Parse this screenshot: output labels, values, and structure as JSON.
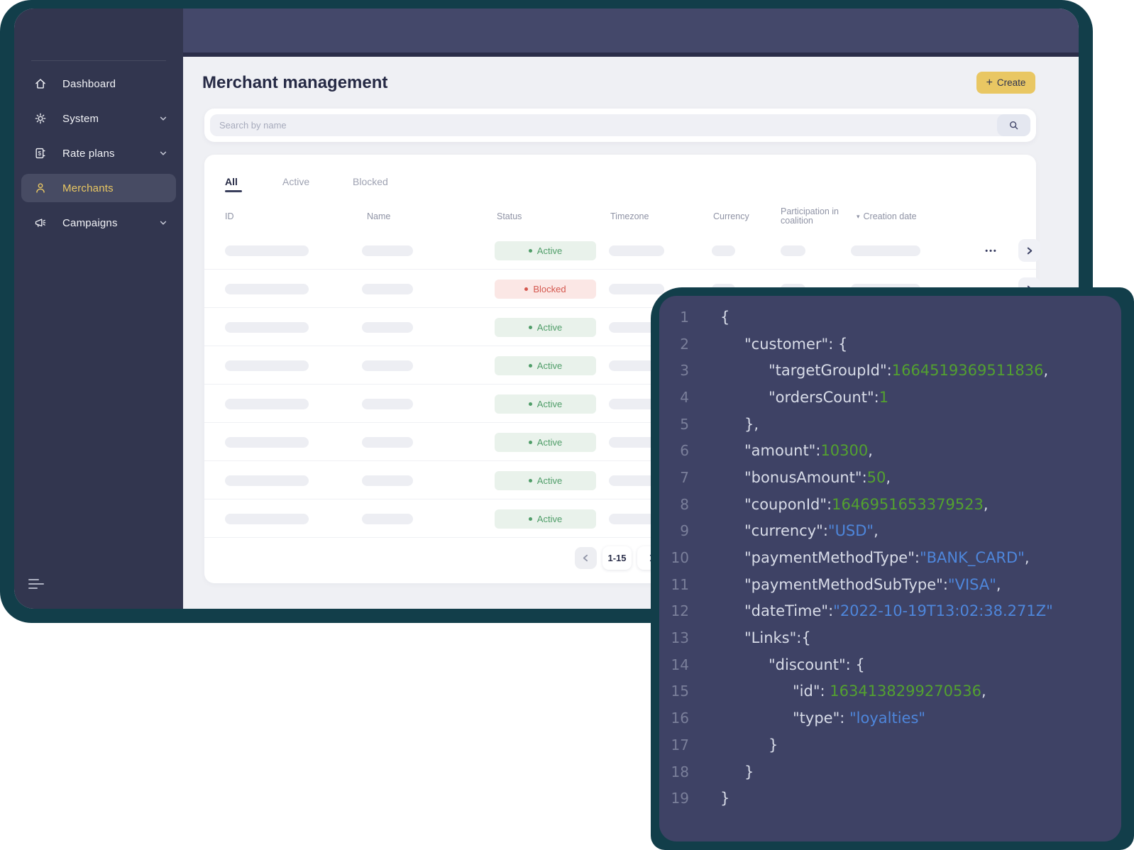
{
  "palette": {
    "teal_frame": "#123E4A",
    "sidebar_bg": "#32364F",
    "topbar_bg": "#44486A",
    "content_bg": "#EFF0F4",
    "accent_gold": "#E9C763",
    "text_dark": "#262A45",
    "text_gray": "#8F93A5",
    "skeleton": "#EDEEF3",
    "active_text": "#4F9D68",
    "active_bg": "#E9F2EB",
    "blocked_text": "#D4574E",
    "blocked_bg": "#FBE7E5",
    "code_panel_bg": "#3E4265",
    "code_line_number": "#7A7F9A",
    "code_key": "#D8DCE8",
    "code_number": "#53A12F",
    "code_string": "#4E86DB"
  },
  "sidebar": {
    "items": [
      {
        "label": "Dashboard",
        "icon": "home-icon",
        "active": false,
        "expandable": false
      },
      {
        "label": "System",
        "icon": "gear-icon",
        "active": false,
        "expandable": true
      },
      {
        "label": "Rate plans",
        "icon": "rate-plans-icon",
        "active": false,
        "expandable": true
      },
      {
        "label": "Merchants",
        "icon": "person-icon",
        "active": true,
        "expandable": false
      },
      {
        "label": "Campaigns",
        "icon": "megaphone-icon",
        "active": false,
        "expandable": true
      }
    ]
  },
  "header": {
    "title": "Merchant management",
    "create_button": "Create",
    "create_plus": "+"
  },
  "search": {
    "placeholder": "Search by name"
  },
  "tabs": [
    {
      "label": "All",
      "active": true
    },
    {
      "label": "Active",
      "active": false
    },
    {
      "label": "Blocked",
      "active": false
    }
  ],
  "table": {
    "columns": [
      "ID",
      "Name",
      "Status",
      "Timezone",
      "Currency",
      "Participation in coalition",
      "Creation date"
    ],
    "sorted_column": "Creation date",
    "sort_caret": "▾",
    "row_menu_glyph": "•••",
    "rows": [
      {
        "status": "Active"
      },
      {
        "status": "Blocked"
      },
      {
        "status": "Active"
      },
      {
        "status": "Active"
      },
      {
        "status": "Active"
      },
      {
        "status": "Active"
      },
      {
        "status": "Active"
      },
      {
        "status": "Active"
      }
    ]
  },
  "pagination": {
    "range": "1-15"
  },
  "code_panel": {
    "lines": [
      {
        "num": 1,
        "indent": 0,
        "tokens": [
          {
            "t": "punc",
            "v": "{"
          }
        ]
      },
      {
        "num": 2,
        "indent": 1,
        "tokens": [
          {
            "t": "key",
            "v": "\"customer\""
          },
          {
            "t": "punc",
            "v": ": {"
          }
        ]
      },
      {
        "num": 3,
        "indent": 2,
        "tokens": [
          {
            "t": "key",
            "v": "\"targetGroupId\""
          },
          {
            "t": "punc",
            "v": ":"
          },
          {
            "t": "num",
            "v": "1664519369511836"
          },
          {
            "t": "punc",
            "v": ","
          }
        ]
      },
      {
        "num": 4,
        "indent": 2,
        "tokens": [
          {
            "t": "key",
            "v": "\"ordersCount\""
          },
          {
            "t": "punc",
            "v": ":"
          },
          {
            "t": "num",
            "v": "1"
          }
        ]
      },
      {
        "num": 5,
        "indent": 1,
        "tokens": [
          {
            "t": "punc",
            "v": "},"
          }
        ]
      },
      {
        "num": 6,
        "indent": 1,
        "tokens": [
          {
            "t": "key",
            "v": "\"amount\""
          },
          {
            "t": "punc",
            "v": ":"
          },
          {
            "t": "num",
            "v": "10300"
          },
          {
            "t": "punc",
            "v": ","
          }
        ]
      },
      {
        "num": 7,
        "indent": 1,
        "tokens": [
          {
            "t": "key",
            "v": "\"bonusAmount\""
          },
          {
            "t": "punc",
            "v": ":"
          },
          {
            "t": "num",
            "v": "50"
          },
          {
            "t": "punc",
            "v": ","
          }
        ]
      },
      {
        "num": 8,
        "indent": 1,
        "tokens": [
          {
            "t": "key",
            "v": "\"couponId\""
          },
          {
            "t": "punc",
            "v": ":"
          },
          {
            "t": "num",
            "v": "1646951653379523"
          },
          {
            "t": "punc",
            "v": ","
          }
        ]
      },
      {
        "num": 9,
        "indent": 1,
        "tokens": [
          {
            "t": "key",
            "v": "\"currency\""
          },
          {
            "t": "punc",
            "v": ":"
          },
          {
            "t": "str",
            "v": "\"USD\""
          },
          {
            "t": "punc",
            "v": ","
          }
        ]
      },
      {
        "num": 10,
        "indent": 1,
        "tokens": [
          {
            "t": "key",
            "v": "\"paymentMethodType\""
          },
          {
            "t": "punc",
            "v": ":"
          },
          {
            "t": "str",
            "v": "\"BANK_CARD\""
          },
          {
            "t": "punc",
            "v": ","
          }
        ]
      },
      {
        "num": 11,
        "indent": 1,
        "tokens": [
          {
            "t": "key",
            "v": "\"paymentMethodSubType\""
          },
          {
            "t": "punc",
            "v": ":"
          },
          {
            "t": "str",
            "v": "\"VISA\""
          },
          {
            "t": "punc",
            "v": ","
          }
        ]
      },
      {
        "num": 12,
        "indent": 1,
        "tokens": [
          {
            "t": "key",
            "v": "\"dateTime\""
          },
          {
            "t": "punc",
            "v": ":"
          },
          {
            "t": "str",
            "v": "\"2022-10-19T13:02:38.271Z\""
          }
        ]
      },
      {
        "num": 13,
        "indent": 1,
        "tokens": [
          {
            "t": "key",
            "v": "\"Links\""
          },
          {
            "t": "punc",
            "v": ":{"
          }
        ]
      },
      {
        "num": 14,
        "indent": 2,
        "tokens": [
          {
            "t": "key",
            "v": "\"discount\""
          },
          {
            "t": "punc",
            "v": ": {"
          }
        ]
      },
      {
        "num": 15,
        "indent": 3,
        "tokens": [
          {
            "t": "key",
            "v": "\"id\""
          },
          {
            "t": "punc",
            "v": ": "
          },
          {
            "t": "num",
            "v": "1634138299270536"
          },
          {
            "t": "punc",
            "v": ","
          }
        ]
      },
      {
        "num": 16,
        "indent": 3,
        "tokens": [
          {
            "t": "key",
            "v": "\"type\""
          },
          {
            "t": "punc",
            "v": ": "
          },
          {
            "t": "str",
            "v": "\"loyalties\""
          }
        ]
      },
      {
        "num": 17,
        "indent": 2,
        "tokens": [
          {
            "t": "punc",
            "v": "}"
          }
        ]
      },
      {
        "num": 18,
        "indent": 1,
        "tokens": [
          {
            "t": "punc",
            "v": "}"
          }
        ]
      },
      {
        "num": 19,
        "indent": 0,
        "tokens": [
          {
            "t": "punc",
            "v": "}"
          }
        ]
      }
    ]
  }
}
